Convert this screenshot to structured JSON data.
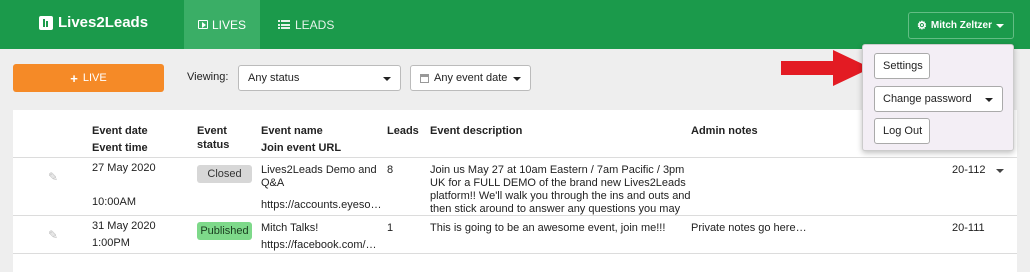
{
  "app": {
    "brand": "Lives2Leads"
  },
  "nav": {
    "tabs": [
      {
        "label": "LIVES",
        "icon": "play-icon",
        "active": true
      },
      {
        "label": "LEADS",
        "icon": "list-icon",
        "active": false
      }
    ],
    "user": {
      "name": "Mitch Zeltzer",
      "icon": "gear-icon"
    }
  },
  "toolbar": {
    "live_button": "LIVE",
    "viewing_label": "Viewing:",
    "status_filter": "Any status",
    "date_filter": "Any event date"
  },
  "table": {
    "headers": {
      "event_date": "Event date",
      "event_time": "Event time",
      "event_status_1": "Event",
      "event_status_2": "status",
      "event_name": "Event name",
      "join_url": "Join event URL",
      "leads": "Leads",
      "description": "Event description",
      "admin_notes": "Admin notes"
    },
    "rows": [
      {
        "date": "27 May 2020",
        "time": "10:00AM",
        "status": "Closed",
        "name_line1": "Lives2Leads Demo and",
        "name_line2": "Q&A",
        "url": "https://accounts.eyeso…",
        "leads": "8",
        "desc_line1": "Join us May 27 at 10am Eastern / 7am Pacific / 3pm",
        "desc_line2": "UK for a FULL DEMO of the brand new Lives2Leads",
        "desc_line3": "platform!! We'll walk you through the ins and outs and",
        "desc_line4": "then stick around to answer any questions you may",
        "notes": "",
        "id": "20-112"
      },
      {
        "date": "31 May 2020",
        "time": "1:00PM",
        "status": "Published",
        "name_line1": "Mitch Talks!",
        "url": "https://facebook.com/…",
        "leads": "1",
        "desc_line1": "This is going to be an awesome event, join me!!!",
        "notes": "Private notes go here…",
        "id": "20-111"
      }
    ]
  },
  "user_menu": {
    "settings": "Settings",
    "change_password": "Change password",
    "logout": "Log Out"
  },
  "colors": {
    "nav_green": "#1b9a4b",
    "live_orange": "#f58a27",
    "published_green": "#7ed98a",
    "arrow_red": "#e31b23"
  }
}
